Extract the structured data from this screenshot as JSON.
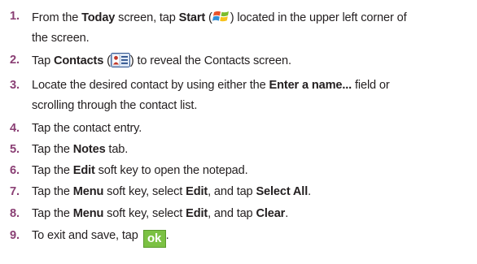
{
  "steps": [
    {
      "number": "1.",
      "a": "From the ",
      "b": "Today",
      "c": " screen, tap ",
      "d": "Start",
      "e": " (",
      "icon": "windows-start-icon",
      "f": ") located in the upper left corner of",
      "line2": "the screen."
    },
    {
      "number": "2.",
      "a": "Tap ",
      "b": "Contacts",
      "c": " (",
      "icon": "contacts-icon",
      "d": ") to reveal the Contacts screen."
    },
    {
      "number": "3.",
      "a": "Locate the desired contact by using either the ",
      "b": "Enter a name...",
      "c": " field or",
      "line2": "scrolling through the contact list."
    },
    {
      "number": "4.",
      "a": "Tap the contact entry."
    },
    {
      "number": "5.",
      "a": "Tap the ",
      "b": "Notes",
      "c": " tab."
    },
    {
      "number": "6.",
      "a": "Tap the ",
      "b": "Edit",
      "c": " soft key to open the notepad."
    },
    {
      "number": "7.",
      "a": "Tap the ",
      "b": "Menu",
      "c": " soft key, select ",
      "d": "Edit",
      "e": ", and tap ",
      "f": "Select All",
      "g": "."
    },
    {
      "number": "8.",
      "a": "Tap the ",
      "b": "Menu",
      "c": " soft key, select ",
      "d": "Edit",
      "e": ", and tap ",
      "f": "Clear",
      "g": "."
    },
    {
      "number": "9.",
      "a": "To exit and save, tap ",
      "ok_label": "ok",
      "b": "."
    }
  ],
  "colors": {
    "step_number": "#8a3f74",
    "text": "#231f20",
    "ok_button": "#7bc143"
  }
}
